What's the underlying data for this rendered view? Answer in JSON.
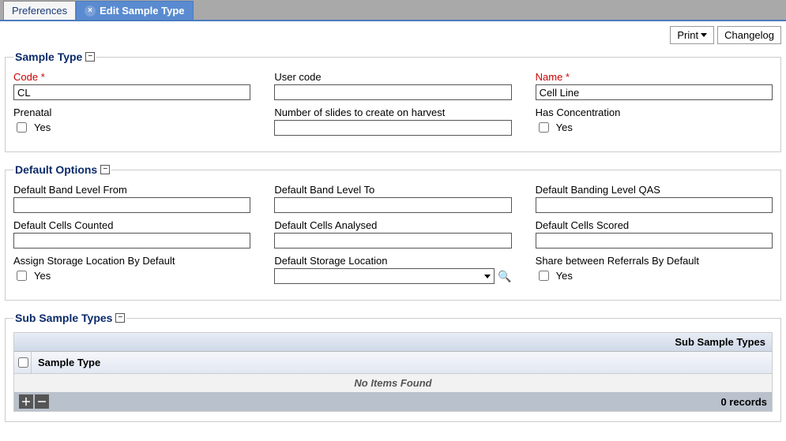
{
  "tabs": {
    "preferences": "Preferences",
    "editSampleType": "Edit Sample Type"
  },
  "toolbar": {
    "print": "Print",
    "changelog": "Changelog"
  },
  "sections": {
    "sampleType": {
      "title": "Sample Type"
    },
    "defaultOptions": {
      "title": "Default Options"
    },
    "subSampleTypes": {
      "title": "Sub Sample Types"
    }
  },
  "fields": {
    "code": {
      "label": "Code *",
      "value": "CL"
    },
    "userCode": {
      "label": "User code",
      "value": ""
    },
    "name": {
      "label": "Name *",
      "value": "Cell Line"
    },
    "prenatal": {
      "label": "Prenatal",
      "yes": "Yes"
    },
    "numSlides": {
      "label": "Number of slides to create on harvest",
      "value": ""
    },
    "hasConc": {
      "label": "Has Concentration",
      "yes": "Yes"
    },
    "bandFrom": {
      "label": "Default Band Level From",
      "value": ""
    },
    "bandTo": {
      "label": "Default Band Level To",
      "value": ""
    },
    "bandQAS": {
      "label": "Default Banding Level QAS",
      "value": ""
    },
    "cellsCounted": {
      "label": "Default Cells Counted",
      "value": ""
    },
    "cellsAnalysed": {
      "label": "Default Cells Analysed",
      "value": ""
    },
    "cellsScored": {
      "label": "Default Cells Scored",
      "value": ""
    },
    "assignStorage": {
      "label": "Assign Storage Location By Default",
      "yes": "Yes"
    },
    "defaultStorage": {
      "label": "Default Storage Location",
      "value": ""
    },
    "shareReferrals": {
      "label": "Share between Referrals By Default",
      "yes": "Yes"
    }
  },
  "subTable": {
    "title": "Sub Sample Types",
    "colSampleType": "Sample Type",
    "empty": "No Items Found",
    "records": "0 records"
  }
}
